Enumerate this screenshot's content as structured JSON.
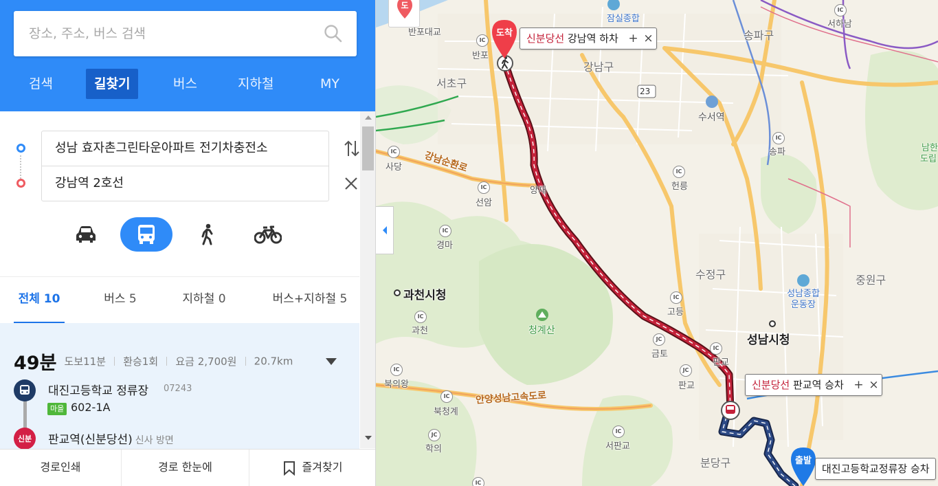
{
  "search": {
    "placeholder": "장소, 주소, 버스 검색"
  },
  "main_tabs": [
    {
      "label": "검색",
      "active": false
    },
    {
      "label": "길찾기",
      "active": true
    },
    {
      "label": "버스",
      "active": false
    },
    {
      "label": "지하철",
      "active": false
    },
    {
      "label": "MY",
      "active": false
    }
  ],
  "route": {
    "origin": "성남 효자촌그린타운아파트 전기차충전소",
    "destination": "강남역 2호선"
  },
  "modes": [
    {
      "icon": "car-icon",
      "active": false
    },
    {
      "icon": "bus-icon",
      "active": true
    },
    {
      "icon": "walk-icon",
      "active": false
    },
    {
      "icon": "bicycle-icon",
      "active": false
    }
  ],
  "filter_tabs": [
    {
      "label": "전체",
      "count": "10",
      "active": true
    },
    {
      "label": "버스",
      "count": "5",
      "active": false
    },
    {
      "label": "지하철",
      "count": "0",
      "active": false
    },
    {
      "label": "버스+지하철",
      "count": "5",
      "active": false
    }
  ],
  "result": {
    "time": "49분",
    "walk": "도보11분",
    "transfers": "환승1회",
    "fare": "요금 2,700원",
    "distance": "20.7km",
    "stop1": {
      "name": "대진고등학교 정류장",
      "code": "07243"
    },
    "bus": {
      "type": "마을",
      "number": "602-1A"
    },
    "line_badge": "신분",
    "stop2": {
      "name": "판교역(신분당선)",
      "direction": "신사 방면"
    }
  },
  "footer": {
    "print": "경로인쇄",
    "overview": "경로 한눈에",
    "bookmark": "즐겨찾기"
  },
  "map": {
    "labels": {
      "banpo_bridge": "반포대교",
      "banpo": "반포",
      "seocho": "서초구",
      "gangnam": "강남구",
      "jamsil": "잠실종합",
      "songpa_gu": "송파구",
      "seohanam": "서하남",
      "suseo": "수서역",
      "songpa": "송파",
      "namhan": "남한",
      "dorip": "도립",
      "sadang": "사당",
      "gangnam_sunhwan": "강남순환로",
      "seonam": "선암",
      "yangjae": "양재",
      "heolleung": "헌릉",
      "gyeongma": "경마",
      "gwacheon_cityhall": "과천시청",
      "cheonggyesan": "청계산",
      "sujeong": "수정구",
      "jungwon": "중원구",
      "seongnam_stadium": "성남종합운동장",
      "godeung": "고등",
      "gwacheon": "과천",
      "seongnam_cityhall": "성남시청",
      "geumto": "금토",
      "pangyo_ic": "판교",
      "bukuiwang": "북의왕",
      "anyang_seongnam_exp": "안양성남고속도로",
      "pangyo": "판교",
      "bukcheonggye": "북청계",
      "hakui": "학의",
      "seopangyo": "서판교",
      "bundang": "분당구",
      "route23": "23"
    },
    "callouts": {
      "dest_line": "신분당선",
      "dest_text": "강남역 하차",
      "transfer_line": "신분당선",
      "transfer_text": "판교역 승차",
      "start_text": "대진고등학교정류장 승차"
    },
    "pins": {
      "arrival": "도착",
      "departure": "출발",
      "top_partial": "도"
    },
    "colors": {
      "subway_route": "#c4223a",
      "bus_route": "#2d4a86",
      "header": "#2f8bf8"
    }
  }
}
